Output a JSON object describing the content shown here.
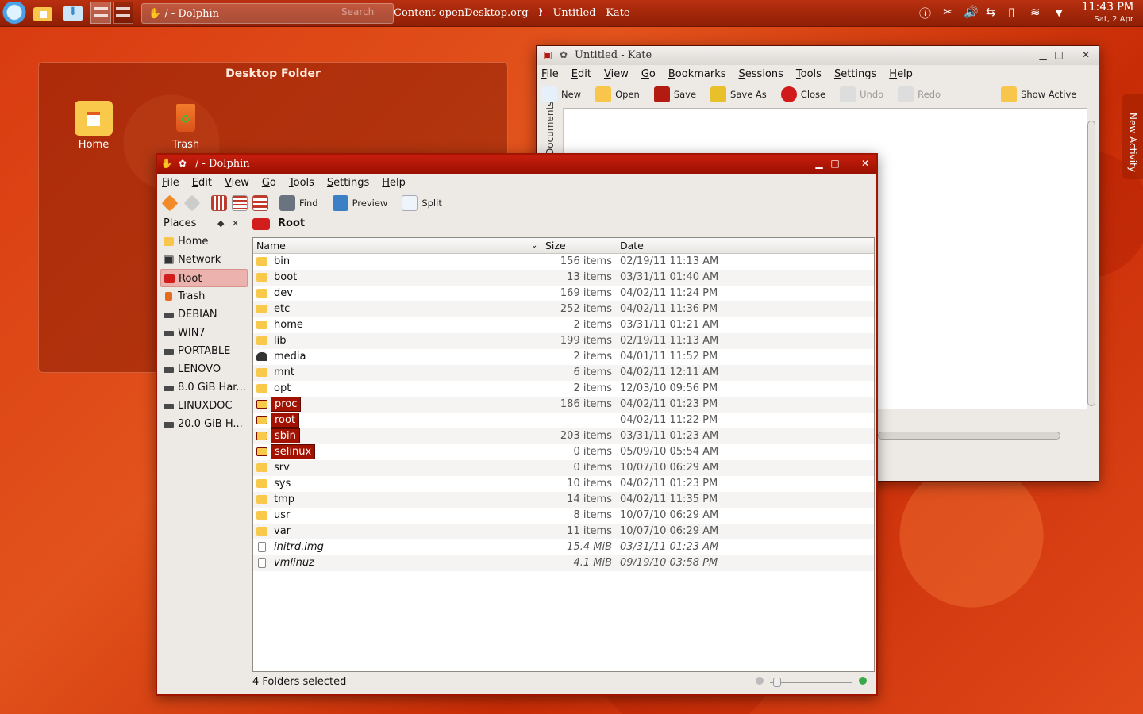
{
  "taskbar": {
    "tasks": [
      "/ - Dolphin",
      "Search",
      "Content openDesktop.org - Mozilla",
      "Untitled - Kate"
    ],
    "clock_time": "11:43 PM",
    "clock_date": "Sat, 2 Apr"
  },
  "desktop_folder": {
    "title": "Desktop Folder",
    "icons": [
      "Home",
      "Trash"
    ]
  },
  "new_activity": "New Activity",
  "kate": {
    "title": "Untitled - Kate",
    "menu": [
      "File",
      "Edit",
      "View",
      "Go",
      "Bookmarks",
      "Sessions",
      "Tools",
      "Settings",
      "Help"
    ],
    "toolbar": [
      "New",
      "Open",
      "Save",
      "Save As",
      "Close",
      "Undo",
      "Redo",
      "Show Active"
    ],
    "side_tab": "Documents"
  },
  "dolphin": {
    "title": "/ - Dolphin",
    "menu": [
      "File",
      "Edit",
      "View",
      "Go",
      "Tools",
      "Settings",
      "Help"
    ],
    "toolbar": [
      "Find",
      "Preview",
      "Split"
    ],
    "places_title": "Places",
    "places": [
      "Home",
      "Network",
      "Root",
      "Trash",
      "DEBIAN",
      "WIN7",
      "PORTABLE",
      "LENOVO",
      "8.0 GiB Har...",
      "LINUXDOC",
      "20.0 GiB H..."
    ],
    "breadcrumb": "Root",
    "columns": [
      "Name",
      "Size",
      "Date"
    ],
    "files": [
      {
        "name": "bin",
        "size": "156 items",
        "date": "02/19/11 11:13 AM"
      },
      {
        "name": "boot",
        "size": "13 items",
        "date": "03/31/11 01:40 AM"
      },
      {
        "name": "dev",
        "size": "169 items",
        "date": "04/02/11 11:24 PM"
      },
      {
        "name": "etc",
        "size": "252 items",
        "date": "04/02/11 11:36 PM"
      },
      {
        "name": "home",
        "size": "2 items",
        "date": "03/31/11 01:21 AM"
      },
      {
        "name": "lib",
        "size": "199 items",
        "date": "02/19/11 11:13 AM"
      },
      {
        "name": "media",
        "size": "2 items",
        "date": "04/01/11 11:52 PM"
      },
      {
        "name": "mnt",
        "size": "6 items",
        "date": "04/02/11 12:11 AM"
      },
      {
        "name": "opt",
        "size": "2 items",
        "date": "12/03/10 09:56 PM"
      },
      {
        "name": "proc",
        "size": "186 items",
        "date": "04/02/11 01:23 PM"
      },
      {
        "name": "root",
        "size": "",
        "date": "04/02/11 11:22 PM"
      },
      {
        "name": "sbin",
        "size": "203 items",
        "date": "03/31/11 01:23 AM"
      },
      {
        "name": "selinux",
        "size": "0 items",
        "date": "05/09/10 05:54 AM"
      },
      {
        "name": "srv",
        "size": "0 items",
        "date": "10/07/10 06:29 AM"
      },
      {
        "name": "sys",
        "size": "10 items",
        "date": "04/02/11 01:23 PM"
      },
      {
        "name": "tmp",
        "size": "14 items",
        "date": "04/02/11 11:35 PM"
      },
      {
        "name": "usr",
        "size": "8 items",
        "date": "10/07/10 06:29 AM"
      },
      {
        "name": "var",
        "size": "11 items",
        "date": "10/07/10 06:29 AM"
      },
      {
        "name": "initrd.img",
        "size": "15.4 MiB",
        "date": "03/31/11 01:23 AM"
      },
      {
        "name": "vmlinuz",
        "size": "4.1 MiB",
        "date": "09/19/10 03:58 PM"
      }
    ],
    "status": "4 Folders selected"
  }
}
